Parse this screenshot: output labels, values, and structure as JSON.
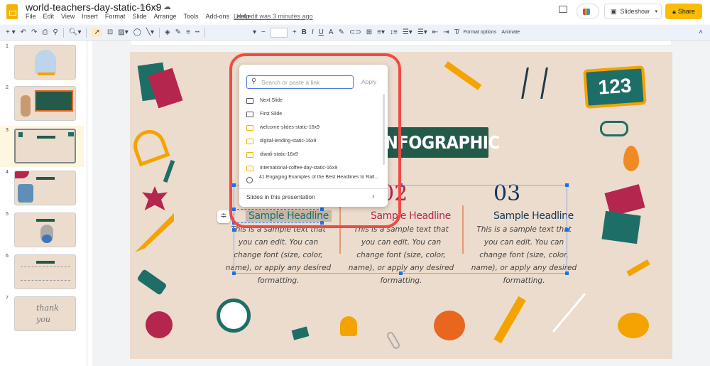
{
  "app": {
    "title": "world-teachers-day-static-16x9",
    "last_edit": "Last edit was 3 minutes ago",
    "menu": [
      "File",
      "Edit",
      "View",
      "Insert",
      "Format",
      "Slide",
      "Arrange",
      "Tools",
      "Add-ons",
      "Help"
    ],
    "slideshow_label": "Slideshow",
    "share_label": "Share"
  },
  "toolbar": {
    "format_options": "Format options",
    "animate": "Animate"
  },
  "filmstrip": {
    "slides": [
      "1",
      "2",
      "3",
      "4",
      "5",
      "6",
      "7"
    ],
    "selected": "3",
    "thumb_text": {
      "s7": "thank you"
    }
  },
  "slide": {
    "banner": "NFOGRAPHIC",
    "columns": [
      {
        "number": "",
        "headline": "Sample Headline",
        "body": "This is a sample text that you can edit. You can change font (size, color, name), or apply any desired formatting.",
        "color": "#1e6e68"
      },
      {
        "number": "02",
        "headline": "Sample Headline",
        "body": "This is a sample text that you can edit. You can change font (size, color, name), or apply any desired formatting.",
        "color": "#b5264f"
      },
      {
        "number": "03",
        "headline": "Sample Headline",
        "body": "This is a sample text that you can edit. You can change font (size, color, name), or apply any desired formatting.",
        "color": "#14375e"
      }
    ],
    "badge": "123"
  },
  "link_popup": {
    "placeholder": "Search or paste a link",
    "apply": "Apply",
    "items": [
      {
        "label": "Next Slide",
        "icon": "slide-icon"
      },
      {
        "label": "First Slide",
        "icon": "slide-icon"
      },
      {
        "label": "welcome-slides-static-16x9",
        "icon": "slides-file-icon"
      },
      {
        "label": "digital-lending-static-16x9",
        "icon": "slides-file-icon"
      },
      {
        "label": "diwali-static-16x9",
        "icon": "slides-file-icon"
      },
      {
        "label": "international-coffee-day-static-16x9",
        "icon": "slides-file-icon"
      },
      {
        "label": "41 Engaging Examples of the Best Headlines to Rall...",
        "icon": "globe-icon"
      }
    ],
    "footer": "Slides in this presentation"
  }
}
